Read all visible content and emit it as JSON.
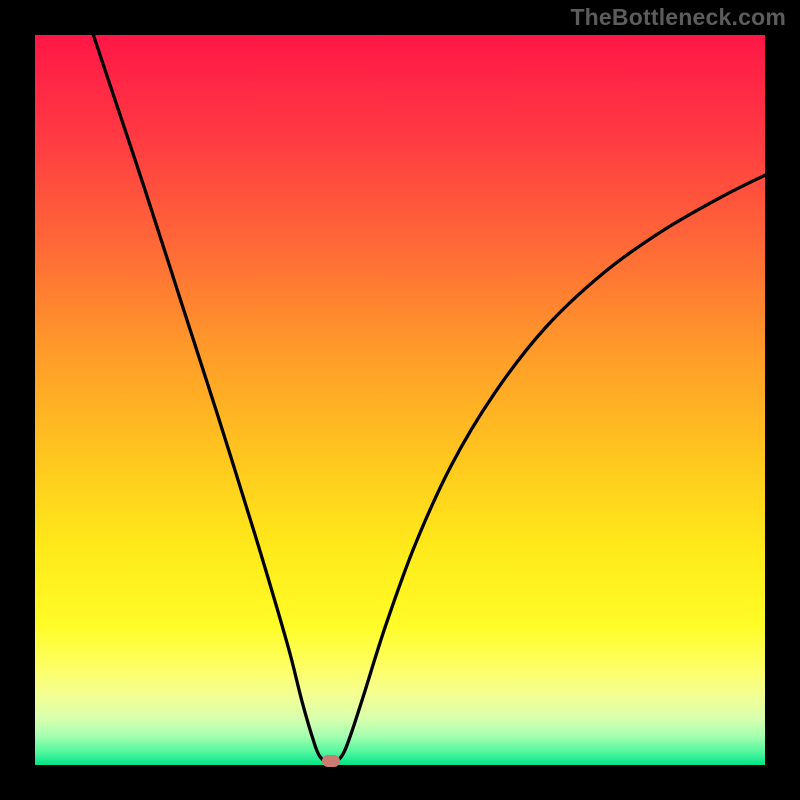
{
  "watermark": "TheBottleneck.com",
  "chart_data": {
    "type": "line",
    "title": "",
    "xlabel": "",
    "ylabel": "",
    "xlim": [
      0,
      100
    ],
    "ylim": [
      0,
      100
    ],
    "minimum_marker": {
      "x": 40.5,
      "y": 0
    },
    "curve": [
      {
        "x": 8.0,
        "y": 100.0
      },
      {
        "x": 10.0,
        "y": 94.0
      },
      {
        "x": 15.0,
        "y": 79.0
      },
      {
        "x": 20.0,
        "y": 63.5
      },
      {
        "x": 25.0,
        "y": 48.0
      },
      {
        "x": 30.0,
        "y": 32.0
      },
      {
        "x": 33.0,
        "y": 22.0
      },
      {
        "x": 35.0,
        "y": 15.0
      },
      {
        "x": 36.5,
        "y": 9.0
      },
      {
        "x": 38.0,
        "y": 3.8
      },
      {
        "x": 39.0,
        "y": 1.2
      },
      {
        "x": 40.5,
        "y": 0.3
      },
      {
        "x": 42.0,
        "y": 1.2
      },
      {
        "x": 43.2,
        "y": 4.0
      },
      {
        "x": 45.0,
        "y": 9.5
      },
      {
        "x": 48.0,
        "y": 19.0
      },
      {
        "x": 52.0,
        "y": 30.0
      },
      {
        "x": 57.0,
        "y": 41.0
      },
      {
        "x": 63.0,
        "y": 51.0
      },
      {
        "x": 70.0,
        "y": 60.0
      },
      {
        "x": 78.0,
        "y": 67.5
      },
      {
        "x": 86.0,
        "y": 73.2
      },
      {
        "x": 94.0,
        "y": 77.8
      },
      {
        "x": 100.0,
        "y": 80.8
      }
    ],
    "gradient_bands": [
      {
        "top": 0.0,
        "bottom": 0.14,
        "from": "#ff1747",
        "to": "#ff3a43"
      },
      {
        "top": 0.14,
        "bottom": 0.28,
        "from": "#ff3a43",
        "to": "#ff6638"
      },
      {
        "top": 0.28,
        "bottom": 0.43,
        "from": "#ff6638",
        "to": "#ff9a2a"
      },
      {
        "top": 0.43,
        "bottom": 0.57,
        "from": "#ff9a2a",
        "to": "#ffc41f"
      },
      {
        "top": 0.57,
        "bottom": 0.7,
        "from": "#ffc41f",
        "to": "#ffe91a"
      },
      {
        "top": 0.7,
        "bottom": 0.81,
        "from": "#ffe91a",
        "to": "#fffc28"
      },
      {
        "top": 0.81,
        "bottom": 0.87,
        "from": "#fffc28",
        "to": "#fdff6a"
      },
      {
        "top": 0.87,
        "bottom": 0.905,
        "from": "#fdff6a",
        "to": "#f3ff94"
      },
      {
        "top": 0.905,
        "bottom": 0.935,
        "from": "#f3ff94",
        "to": "#d8ffad"
      },
      {
        "top": 0.935,
        "bottom": 0.96,
        "from": "#d8ffad",
        "to": "#a5ffb0"
      },
      {
        "top": 0.96,
        "bottom": 0.982,
        "from": "#a5ffb0",
        "to": "#52f7a0"
      },
      {
        "top": 0.982,
        "bottom": 1.0,
        "from": "#52f7a0",
        "to": "#00e486"
      }
    ]
  }
}
